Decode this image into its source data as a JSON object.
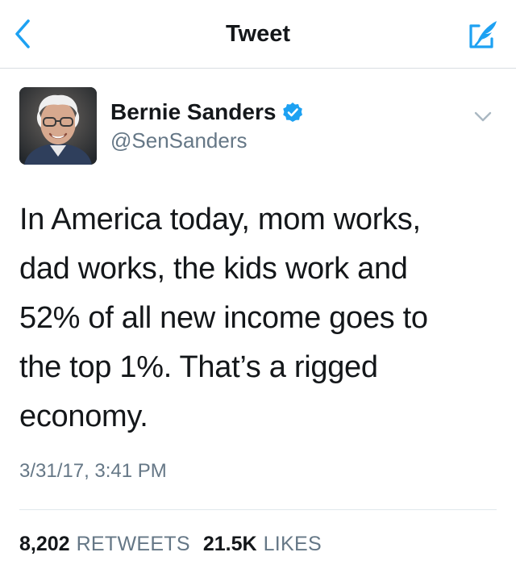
{
  "header": {
    "title": "Tweet",
    "back_icon": "chevron-left-icon",
    "compose_icon": "compose-quill-icon"
  },
  "author": {
    "name": "Bernie Sanders",
    "handle": "@SenSanders",
    "verified": true
  },
  "tweet": {
    "lines": [
      "In America today, mom works,",
      "dad works, the kids work and",
      "52% of all new income goes to",
      "the top 1%. That’s a rigged",
      "economy."
    ],
    "timestamp": "3/31/17, 3:41 PM"
  },
  "stats": {
    "retweets_count": "8,202",
    "retweets_label": "RETWEETS",
    "likes_count": "21.5K",
    "likes_label": "LIKES"
  },
  "colors": {
    "accent": "#1da1f2",
    "text_primary": "#14171a",
    "text_secondary": "#657786",
    "divider": "#e1e8ed"
  }
}
